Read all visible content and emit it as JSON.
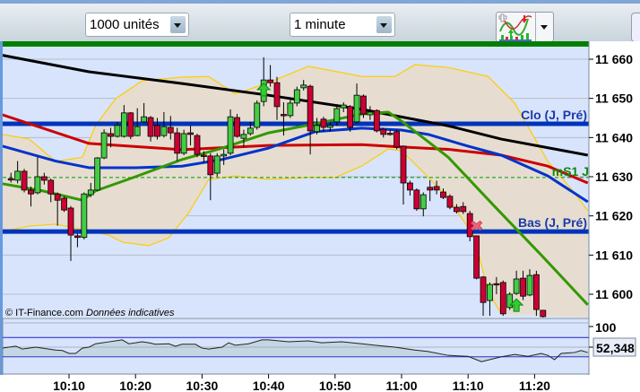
{
  "toolbar": {
    "quantity_select": "1000 unités",
    "interval_select": "1 minute",
    "indicators_button_icon": "chart-indicators-icon"
  },
  "colors": {
    "plot_bg": "#d8e4fc",
    "band_fill": "#e6ddd0",
    "bull": "#44cc44",
    "bear": "#cc0033",
    "ma_black": "#000000",
    "ma_red": "#cc0000",
    "ma_blue": "#0033cc",
    "ma_green": "#339900",
    "bollinger": "#ffcc00",
    "level_line": "#0033bb",
    "pivot_line": "#009900"
  },
  "watermark": {
    "copyright": "© IT-Finance.com",
    "note": "Données indicatives"
  },
  "chart_data": {
    "type": "candlestick",
    "interval": "1 minute",
    "ylim": [
      11594,
      11662
    ],
    "y_ticks": [
      "11 660",
      "11 650",
      "11 640",
      "11 630",
      "11 620",
      "11 610",
      "11 600"
    ],
    "y_tick_values": [
      11660,
      11650,
      11640,
      11630,
      11620,
      11610,
      11600
    ],
    "x_ticks": [
      "10:10",
      "10:20",
      "10:30",
      "10:40",
      "10:50",
      "11:00",
      "11:10",
      "11:20"
    ],
    "grid": true,
    "candles_columns": [
      "time",
      "open",
      "high",
      "low",
      "close"
    ],
    "candles": [
      [
        "10:01",
        11629.5,
        11631,
        11628.5,
        11629.2
      ],
      [
        "10:02",
        11629.1,
        11634,
        11628.3,
        11631.4
      ],
      [
        "10:03",
        11631.4,
        11632,
        11626,
        11626.6
      ],
      [
        "10:04",
        11626.6,
        11627.5,
        11622.4,
        11625.6
      ],
      [
        "10:05",
        11625.9,
        11635,
        11625.5,
        11630
      ],
      [
        "10:06",
        11630,
        11631,
        11628,
        11629.1
      ],
      [
        "10:07",
        11629.1,
        11629.5,
        11623.5,
        11625.6
      ],
      [
        "10:08",
        11625.6,
        11626,
        11617.5,
        11624
      ],
      [
        "10:09",
        11624.5,
        11625,
        11621,
        11621.5
      ],
      [
        "10:10",
        11622,
        11622.5,
        11608.5,
        11615.1
      ],
      [
        "10:11",
        11614.9,
        11615.5,
        11612,
        11614.5
      ],
      [
        "10:12",
        11614.5,
        11626,
        11614,
        11625.6
      ],
      [
        "10:13",
        11625.4,
        11628.4,
        11624.8,
        11626.6
      ],
      [
        "10:14",
        11626.6,
        11635,
        11626.3,
        11634.8
      ],
      [
        "10:15",
        11634.8,
        11642.1,
        11634.5,
        11641.2
      ],
      [
        "10:16",
        11641,
        11642.5,
        11637.5,
        11640.3
      ],
      [
        "10:17",
        11640.3,
        11644,
        11640,
        11643.1
      ],
      [
        "10:18",
        11640.3,
        11648.3,
        11640,
        11646.3
      ],
      [
        "10:19",
        11646.3,
        11646.5,
        11639.6,
        11640.3
      ],
      [
        "10:20",
        11640.5,
        11647.5,
        11640.3,
        11642.8
      ],
      [
        "10:21",
        11644,
        11648.8,
        11643.5,
        11645.3
      ],
      [
        "10:22",
        11645.1,
        11645.5,
        11639,
        11640.3
      ],
      [
        "10:23",
        11643.1,
        11645,
        11639.5,
        11640.3
      ],
      [
        "10:24",
        11640.5,
        11646.5,
        11640,
        11642.8
      ],
      [
        "10:25",
        11642.6,
        11645.5,
        11639.5,
        11641.2
      ],
      [
        "10:26",
        11641.2,
        11642.5,
        11634,
        11636
      ],
      [
        "10:27",
        11636,
        11642,
        11635.5,
        11641
      ],
      [
        "10:28",
        11641.2,
        11643,
        11638,
        11640.8
      ],
      [
        "10:29",
        11640.5,
        11641,
        11635,
        11635.7
      ],
      [
        "10:30",
        11635.5,
        11636.5,
        11633.5,
        11635.2
      ],
      [
        "10:31",
        11635.3,
        11636,
        11624,
        11630.5
      ],
      [
        "10:32",
        11630.9,
        11636,
        11630,
        11635.3
      ],
      [
        "10:33",
        11635.3,
        11637,
        11633,
        11635.7
      ],
      [
        "10:34",
        11636,
        11647.2,
        11635.5,
        11645.3
      ],
      [
        "10:35",
        11645.1,
        11646,
        11640,
        11640.3
      ],
      [
        "10:36",
        11639.8,
        11642,
        11637.5,
        11640.8
      ],
      [
        "10:37",
        11641,
        11644,
        11640.5,
        11642.4
      ],
      [
        "10:38",
        11642.6,
        11649.5,
        11642,
        11648.8
      ],
      [
        "10:39",
        11649.2,
        11660.5,
        11648,
        11654.7
      ],
      [
        "10:40",
        11654.7,
        11658.5,
        11653,
        11654
      ],
      [
        "10:41",
        11654,
        11655.5,
        11644.5,
        11647.9
      ],
      [
        "10:42",
        11645.9,
        11649,
        11640.5,
        11645.6
      ],
      [
        "10:43",
        11645.6,
        11650,
        11645,
        11648.8
      ],
      [
        "10:44",
        11648.8,
        11653,
        11648,
        11652.2
      ],
      [
        "10:45",
        11652.7,
        11654.7,
        11652,
        11653.4
      ],
      [
        "10:46",
        11653.1,
        11653.5,
        11635.7,
        11641.7
      ],
      [
        "10:47",
        11641.5,
        11645,
        11640.8,
        11643.1
      ],
      [
        "10:48",
        11644.7,
        11645.3,
        11641.5,
        11642.6
      ],
      [
        "10:49",
        11642.6,
        11644,
        11641.5,
        11643.1
      ],
      [
        "10:50",
        11644,
        11648.5,
        11643,
        11647.4
      ],
      [
        "10:51",
        11647.6,
        11649,
        11646.5,
        11648.3
      ],
      [
        "10:52",
        11647.9,
        11648.3,
        11641.5,
        11642.6
      ],
      [
        "10:53",
        11644,
        11653.8,
        11643.5,
        11650.8
      ],
      [
        "10:54",
        11650.6,
        11651,
        11645,
        11646
      ],
      [
        "10:55",
        11645.8,
        11648,
        11644.5,
        11646.5
      ],
      [
        "10:56",
        11646.9,
        11647.2,
        11641.3,
        11641.7
      ],
      [
        "10:57",
        11642.1,
        11642.5,
        11640,
        11640.8
      ],
      [
        "10:58",
        11641.1,
        11642,
        11640.5,
        11640.9
      ],
      [
        "10:59",
        11641.5,
        11642,
        11637,
        11637.6
      ],
      [
        "11:00",
        11637.8,
        11638,
        11622.9,
        11628.4
      ],
      [
        "11:01",
        11628.4,
        11629,
        11625.2,
        11626.6
      ],
      [
        "11:02",
        11626.6,
        11627,
        11621.3,
        11621.8
      ],
      [
        "11:03",
        11621.8,
        11626,
        11619.9,
        11625.4
      ],
      [
        "11:04",
        11627.3,
        11629.1,
        11623.8,
        11626.6
      ],
      [
        "11:05",
        11627.5,
        11629,
        11625.5,
        11626.6
      ],
      [
        "11:06",
        11626.1,
        11627,
        11624.3,
        11624.7
      ],
      [
        "11:07",
        11625,
        11625.5,
        11621.7,
        11622.2
      ],
      [
        "11:08",
        11622.2,
        11623,
        11620.6,
        11621.1
      ],
      [
        "11:09",
        11622.4,
        11623.5,
        11620.5,
        11621.1
      ],
      [
        "11:10",
        11620.6,
        11621.3,
        11613.5,
        11614.7
      ],
      [
        "11:11",
        11614.9,
        11615,
        11603.8,
        11604.1
      ],
      [
        "11:12",
        11604.4,
        11604.6,
        11594.5,
        11597.9
      ],
      [
        "11:13",
        11598.4,
        11603,
        11594.5,
        11602.5
      ],
      [
        "11:14",
        11602.7,
        11604.4,
        11600,
        11602.5
      ],
      [
        "11:15",
        11603,
        11603.5,
        11594.5,
        11595
      ],
      [
        "11:16",
        11596.6,
        11600.5,
        11596,
        11600
      ],
      [
        "11:17",
        11600.2,
        11606,
        11599.8,
        11603.9
      ],
      [
        "11:18",
        11604.1,
        11606,
        11598.5,
        11599.5
      ],
      [
        "11:19",
        11599.8,
        11606.4,
        11599.5,
        11604.8
      ],
      [
        "11:20",
        11605,
        11606,
        11594.5,
        11596.1
      ],
      [
        "11:21",
        11595.9,
        11596,
        11593,
        11594.3
      ]
    ],
    "moving_averages": [
      {
        "color": "#000000",
        "points": [
          [
            "10:00",
            11661
          ],
          [
            "10:13",
            11656.8
          ],
          [
            "10:27",
            11653.8
          ],
          [
            "10:40",
            11650.8
          ],
          [
            "10:54",
            11647.2
          ],
          [
            "11:07",
            11643
          ],
          [
            "11:15",
            11639.6
          ],
          [
            "11:28",
            11635.5
          ]
        ]
      },
      {
        "color": "#cc0000",
        "points": [
          [
            "10:00",
            11645.8
          ],
          [
            "10:13",
            11638.5
          ],
          [
            "10:27",
            11636.9
          ],
          [
            "10:40",
            11638
          ],
          [
            "10:54",
            11638.2
          ],
          [
            "11:00",
            11637.6
          ],
          [
            "11:07",
            11637
          ],
          [
            "11:15",
            11635.5
          ],
          [
            "11:22",
            11632.7
          ],
          [
            "11:28",
            11628.4
          ]
        ]
      },
      {
        "color": "#0033cc",
        "points": [
          [
            "10:00",
            11637.8
          ],
          [
            "10:08",
            11634
          ],
          [
            "10:13",
            11632.3
          ],
          [
            "10:20",
            11632.3
          ],
          [
            "10:27",
            11632.7
          ],
          [
            "10:33",
            11634.4
          ],
          [
            "10:40",
            11637.3
          ],
          [
            "10:47",
            11641.5
          ],
          [
            "10:54",
            11642.4
          ],
          [
            "11:00",
            11641.9
          ],
          [
            "11:04",
            11640.8
          ],
          [
            "11:10",
            11637.8
          ],
          [
            "11:15",
            11635.5
          ],
          [
            "11:22",
            11630.2
          ],
          [
            "11:28",
            11623.6
          ]
        ]
      },
      {
        "color": "#339900",
        "points": [
          [
            "10:00",
            11628.2
          ],
          [
            "10:06",
            11626.4
          ],
          [
            "10:12",
            11624
          ],
          [
            "10:14",
            11626.4
          ],
          [
            "10:20",
            11630
          ],
          [
            "10:27",
            11634.4
          ],
          [
            "10:33",
            11637.3
          ],
          [
            "10:40",
            11641.2
          ],
          [
            "10:47",
            11643.5
          ],
          [
            "10:54",
            11646
          ],
          [
            "10:58",
            11646.5
          ],
          [
            "11:00",
            11644.2
          ],
          [
            "11:07",
            11635
          ],
          [
            "11:14",
            11622.4
          ],
          [
            "11:21",
            11610
          ],
          [
            "11:28",
            11597.3
          ]
        ]
      }
    ],
    "bollinger": {
      "upper": [
        [
          "10:00",
          11640.8
        ],
        [
          "10:04",
          11639.6
        ],
        [
          "10:08",
          11633.9
        ],
        [
          "10:12",
          11635
        ],
        [
          "10:14",
          11643.1
        ],
        [
          "10:17",
          11649.9
        ],
        [
          "10:21",
          11654.5
        ],
        [
          "10:27",
          11655.4
        ],
        [
          "10:31",
          11655.6
        ],
        [
          "10:35",
          11651.1
        ],
        [
          "10:40",
          11654
        ],
        [
          "10:46",
          11658.2
        ],
        [
          "10:54",
          11655.6
        ],
        [
          "10:59",
          11655.6
        ],
        [
          "11:02",
          11658.6
        ],
        [
          "11:07",
          11657.9
        ],
        [
          "11:13",
          11655.6
        ],
        [
          "11:17",
          11648.8
        ],
        [
          "11:22",
          11633.9
        ],
        [
          "11:26",
          11625.9
        ],
        [
          "11:28",
          11621.3
        ]
      ],
      "lower": [
        [
          "10:00",
          11616
        ],
        [
          "10:04",
          11617.4
        ],
        [
          "10:08",
          11617.9
        ],
        [
          "10:12",
          11616.5
        ],
        [
          "10:16",
          11615.1
        ],
        [
          "10:18",
          11613.3
        ],
        [
          "10:22",
          11612.4
        ],
        [
          "10:25",
          11614.4
        ],
        [
          "10:28",
          11620.8
        ],
        [
          "10:31",
          11629.3
        ],
        [
          "10:35",
          11630.2
        ],
        [
          "10:40",
          11629.3
        ],
        [
          "10:46",
          11629.8
        ],
        [
          "10:50",
          11629.8
        ],
        [
          "10:54",
          11632.7
        ],
        [
          "10:58",
          11637.1
        ],
        [
          "11:00",
          11636.6
        ],
        [
          "11:03",
          11631.6
        ],
        [
          "11:07",
          11624.7
        ],
        [
          "11:11",
          11614.4
        ],
        [
          "11:13",
          11600.7
        ],
        [
          "11:15",
          11595
        ]
      ]
    },
    "levels": [
      {
        "label": "Clo (J, Pré)",
        "value": 11643.5,
        "style": "solid"
      },
      {
        "label": "Bas (J, Pré)",
        "value": 11616,
        "style": "solid"
      },
      {
        "label": "mS1 J",
        "value": 11629.8,
        "style": "dashed"
      }
    ],
    "signals": [
      {
        "type": "buy-arrow",
        "time": "10:39",
        "price": 11652
      },
      {
        "type": "buy-arrow",
        "time": "11:17",
        "price": 11597
      },
      {
        "type": "sell-cross",
        "time": "11:11",
        "price": 11617.5
      }
    ],
    "oscillator": {
      "ylim": [
        0,
        100
      ],
      "top_label": "100",
      "current_value": "52,348",
      "levels": [
        70,
        30
      ],
      "points": [
        [
          "10:00",
          48
        ],
        [
          "10:02",
          52
        ],
        [
          "10:03",
          46
        ],
        [
          "10:05",
          50
        ],
        [
          "10:08",
          44
        ],
        [
          "10:09",
          43
        ],
        [
          "10:10",
          37
        ],
        [
          "10:11",
          37
        ],
        [
          "10:12",
          48
        ],
        [
          "10:13",
          50
        ],
        [
          "10:14",
          57
        ],
        [
          "10:16",
          61
        ],
        [
          "10:18",
          65
        ],
        [
          "10:19",
          57
        ],
        [
          "10:21",
          61
        ],
        [
          "10:22",
          59
        ],
        [
          "10:23",
          56
        ],
        [
          "10:25",
          57
        ],
        [
          "10:26",
          52
        ],
        [
          "10:27",
          56
        ],
        [
          "10:29",
          56
        ],
        [
          "10:30",
          48
        ],
        [
          "10:31",
          46
        ],
        [
          "10:33",
          50
        ],
        [
          "10:34",
          59
        ],
        [
          "10:35",
          54
        ],
        [
          "10:37",
          57
        ],
        [
          "10:39",
          65
        ],
        [
          "10:40",
          65
        ],
        [
          "10:43",
          61
        ],
        [
          "10:46",
          63
        ],
        [
          "10:48",
          59
        ],
        [
          "10:51",
          61
        ],
        [
          "10:54",
          57
        ],
        [
          "10:56",
          54
        ],
        [
          "10:59",
          50
        ],
        [
          "11:02",
          44
        ],
        [
          "11:04",
          41
        ],
        [
          "11:07",
          33
        ],
        [
          "11:10",
          31
        ],
        [
          "11:12",
          20
        ],
        [
          "11:15",
          30
        ],
        [
          "11:17",
          35
        ],
        [
          "11:19",
          31
        ],
        [
          "11:21",
          37
        ],
        [
          "11:22",
          33
        ],
        [
          "11:23",
          24
        ],
        [
          "11:24",
          37
        ],
        [
          "11:26",
          39
        ],
        [
          "11:27",
          43
        ],
        [
          "11:28",
          39
        ]
      ]
    }
  }
}
